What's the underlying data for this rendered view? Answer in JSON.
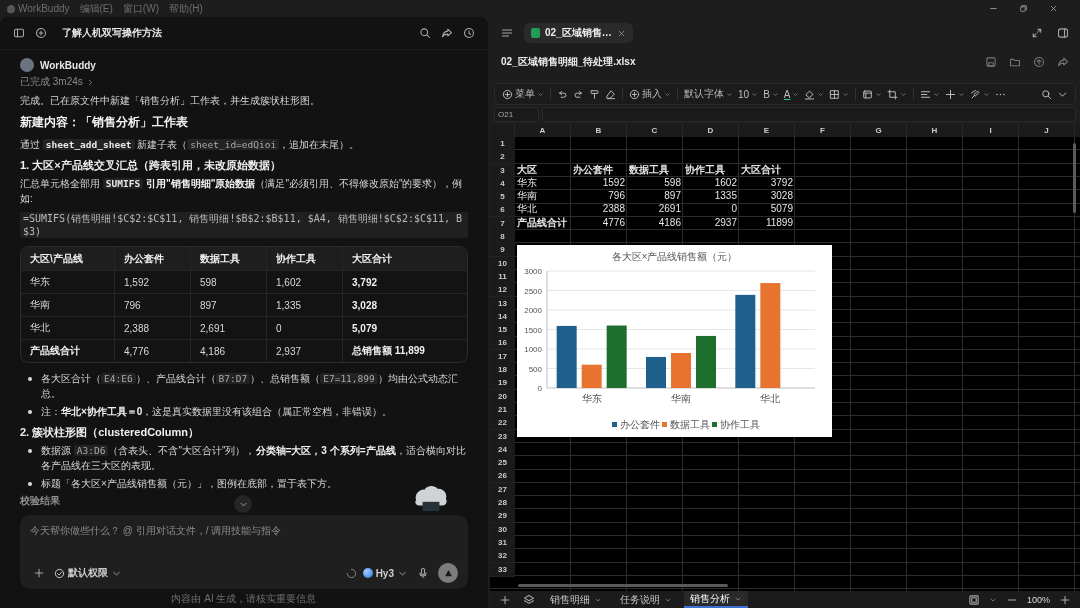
{
  "menu_bar": {
    "app_name": "WorkBuddy",
    "items": [
      "编辑(E)",
      "窗口(W)",
      "帮助(H)"
    ]
  },
  "chat": {
    "title": "了解人机双写操作方法",
    "sender": "WorkBuddy",
    "status": "已完成 3m24s",
    "blocks": [
      {
        "kind": "paragraph",
        "parts": [
          {
            "kind": "text",
            "text": "完成。已在原文件中新建「销售分析」工作表，并生成簇状柱形图。"
          }
        ]
      },
      {
        "kind": "heading",
        "text": "新建内容：「销售分析」工作表"
      },
      {
        "kind": "paragraph",
        "parts": [
          {
            "kind": "text",
            "text": "通过 "
          },
          {
            "kind": "code_bold",
            "text": "sheet_add_sheet"
          },
          {
            "kind": "text",
            "text": " 新建子表（"
          },
          {
            "kind": "code",
            "text": "sheet_id=edQioi"
          },
          {
            "kind": "text",
            "text": "，追加在末尾）。"
          }
        ]
      },
      {
        "kind": "subheading",
        "text": "1. 大区×产品线交叉汇总（跨表引用，未改原始数据）"
      },
      {
        "kind": "paragraph",
        "parts": [
          {
            "kind": "text",
            "text": "汇总单元格全部用 "
          },
          {
            "kind": "code_bold",
            "text": "SUMIFS"
          },
          {
            "kind": "bold",
            "text": " 引用\"销售明细\"原始数据"
          },
          {
            "kind": "text",
            "text": "（满足\"必须引用、不得修改原始\"的要求），例如:"
          }
        ]
      },
      {
        "kind": "code_line",
        "text": "=SUMIFS(销售明细!$C$2:$C$11, 销售明细!$B$2:$B$11, $A4, 销售明细!$C$2:$C$11, B$3)"
      },
      {
        "kind": "table",
        "columns": [
          "大区\\产品线",
          "办公套件",
          "数据工具",
          "协作工具",
          "大区合计"
        ],
        "rows": [
          {
            "kind": "data",
            "cells": [
              "华东",
              "1,592",
              "598",
              "1,602",
              "3,792"
            ]
          },
          {
            "kind": "data",
            "cells": [
              "华南",
              "796",
              "897",
              "1,335",
              "3,028"
            ]
          },
          {
            "kind": "data",
            "cells": [
              "华北",
              "2,388",
              "2,691",
              "0",
              "5,079"
            ]
          },
          {
            "kind": "total",
            "cells": [
              "产品线合计",
              "4,776",
              "4,186",
              "2,937",
              "总销售额 11,899"
            ]
          }
        ]
      },
      {
        "kind": "bullet",
        "parts": [
          {
            "kind": "text",
            "text": "各大区合计（"
          },
          {
            "kind": "code",
            "text": "E4:E6"
          },
          {
            "kind": "text",
            "text": "）、产品线合计（"
          },
          {
            "kind": "code",
            "text": "B7:D7"
          },
          {
            "kind": "text",
            "text": "）、总销售额（"
          },
          {
            "kind": "code",
            "text": "E7=11,899"
          },
          {
            "kind": "text",
            "text": "）均由公式动态汇总。"
          }
        ]
      },
      {
        "kind": "bullet",
        "parts": [
          {
            "kind": "text",
            "text": "注："
          },
          {
            "kind": "bold",
            "text": "华北×协作工具＝0"
          },
          {
            "kind": "text",
            "text": "，这是真实数据里没有该组合（属正常空档，非错误）。"
          }
        ]
      },
      {
        "kind": "subheading",
        "text": "2. 簇状柱形图（clusteredColumn）"
      },
      {
        "kind": "bullet",
        "parts": [
          {
            "kind": "text",
            "text": "数据源 "
          },
          {
            "kind": "code",
            "text": "A3:D6"
          },
          {
            "kind": "text",
            "text": "（含表头、不含\"大区合计\"列），"
          },
          {
            "kind": "bold",
            "text": "分类轴=大区，3 个系列=产品线"
          },
          {
            "kind": "text",
            "text": "，适合横向对比各产品线在三大区的表现。"
          }
        ]
      },
      {
        "kind": "bullet",
        "parts": [
          {
            "kind": "text",
            "text": "标题「各大区×产品线销售额（元）」，图例在底部，置于表下方。"
          }
        ]
      }
    ],
    "trailing_heading": "校验结果",
    "input": {
      "placeholder": "今天帮你做些什么？ @ 引用对话文件，/ 调用技能与指令",
      "permission": "默认权限",
      "model": "Hy3"
    },
    "footer": "内容由 AI 生成，请核实重要信息"
  },
  "editor": {
    "tab_title": "02_区域销售…",
    "file_name": "02_区域销售明细_待处理.xlsx",
    "toolbar": {
      "menu": "菜单",
      "insert": "插入",
      "font": "默认字体",
      "font_size": "10",
      "bold": "B",
      "font_color": "A"
    },
    "name_box": "O21",
    "columns": [
      "A",
      "B",
      "C",
      "D",
      "E",
      "F",
      "G",
      "H",
      "I",
      "J"
    ],
    "rows": [
      {
        "number": "1",
        "kind": "blank"
      },
      {
        "number": "2",
        "kind": "blank"
      },
      {
        "number": "3",
        "kind": "header",
        "cells": [
          "大区",
          "办公套件",
          "数据工具",
          "协作工具",
          "大区合计"
        ]
      },
      {
        "number": "4",
        "kind": "data",
        "cells": [
          "华东",
          "1592",
          "598",
          "1602",
          "3792"
        ]
      },
      {
        "number": "5",
        "kind": "data",
        "cells": [
          "华南",
          "796",
          "897",
          "1335",
          "3028"
        ]
      },
      {
        "number": "6",
        "kind": "data",
        "cells": [
          "华北",
          "2388",
          "2691",
          "0",
          "5079"
        ]
      },
      {
        "number": "7",
        "kind": "total",
        "cells": [
          "产品线合计",
          "4776",
          "4186",
          "2937",
          "11899"
        ]
      },
      {
        "number": "8",
        "kind": "blank"
      },
      {
        "number": "9",
        "kind": "blank"
      },
      {
        "number": "10",
        "kind": "blank"
      },
      {
        "number": "11",
        "kind": "blank"
      },
      {
        "number": "12",
        "kind": "blank"
      },
      {
        "number": "13",
        "kind": "blank"
      },
      {
        "number": "14",
        "kind": "blank"
      },
      {
        "number": "15",
        "kind": "blank"
      },
      {
        "number": "16",
        "kind": "blank"
      },
      {
        "number": "17",
        "kind": "blank"
      },
      {
        "number": "18",
        "kind": "blank"
      },
      {
        "number": "19",
        "kind": "blank"
      },
      {
        "number": "20",
        "kind": "blank"
      },
      {
        "number": "21",
        "kind": "blank"
      },
      {
        "number": "22",
        "kind": "blank"
      },
      {
        "number": "23",
        "kind": "blank"
      },
      {
        "number": "24",
        "kind": "blank"
      },
      {
        "number": "25",
        "kind": "blank"
      },
      {
        "number": "26",
        "kind": "blank"
      },
      {
        "number": "27",
        "kind": "blank"
      },
      {
        "number": "28",
        "kind": "blank"
      },
      {
        "number": "29",
        "kind": "blank"
      },
      {
        "number": "30",
        "kind": "blank"
      },
      {
        "number": "31",
        "kind": "blank"
      },
      {
        "number": "32",
        "kind": "blank"
      },
      {
        "number": "33",
        "kind": "blank"
      }
    ],
    "chart_data": {
      "type": "bar",
      "title": "各大区×产品线销售额（元）",
      "categories": [
        "华东",
        "华南",
        "华北"
      ],
      "series": [
        {
          "name": "办公套件",
          "color": "#1f5f8b",
          "values": [
            1592,
            796,
            2388
          ]
        },
        {
          "name": "数据工具",
          "color": "#e8732f",
          "values": [
            598,
            897,
            2691
          ]
        },
        {
          "name": "协作工具",
          "color": "#1e6e2e",
          "values": [
            1602,
            1335,
            0
          ]
        }
      ],
      "ylim": [
        0,
        3000
      ],
      "yticks": [
        0,
        500,
        1000,
        1500,
        2000,
        2500,
        3000
      ],
      "grid": true,
      "legend": true
    },
    "sheets": [
      {
        "label": "销售明细",
        "selected": false
      },
      {
        "label": "任务说明",
        "selected": false
      },
      {
        "label": "销售分析",
        "selected": true
      }
    ],
    "zoom": "100%"
  }
}
